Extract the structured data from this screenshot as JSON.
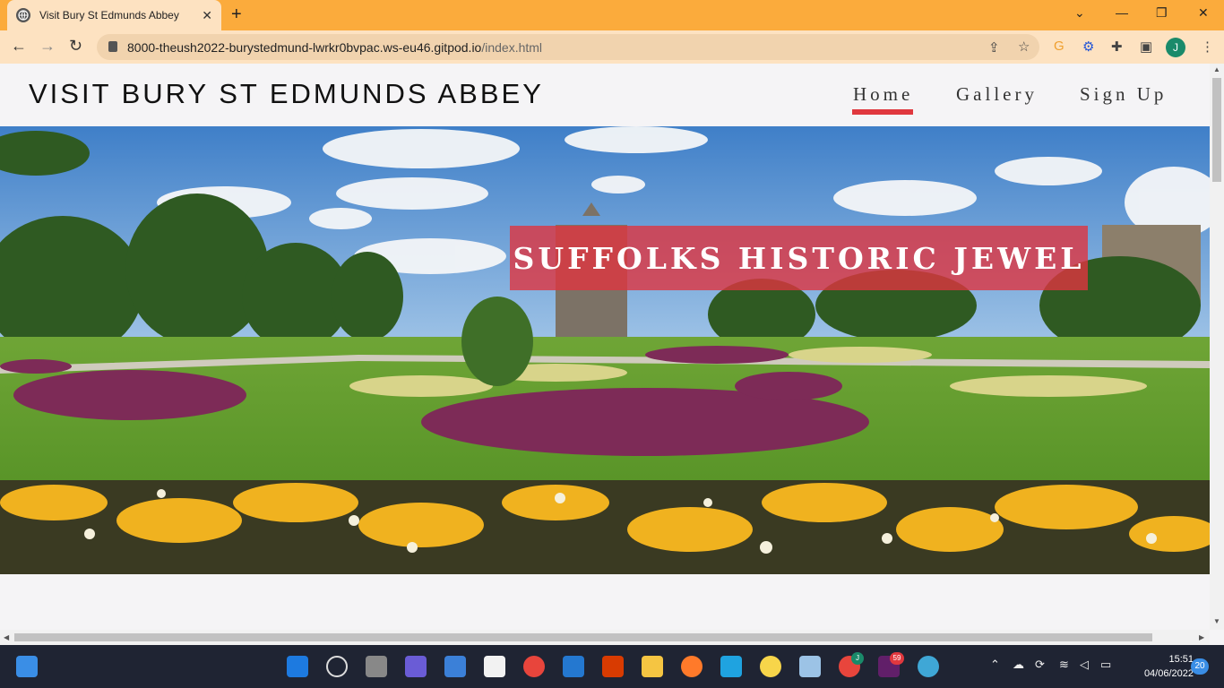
{
  "browser": {
    "tab_title": "Visit Bury St Edmunds Abbey",
    "url_host": "8000-theush2022-burystedmund-lwrkr0bvpac.ws-eu46.gitpod.io",
    "url_path": "/index.html",
    "profile_initial": "J"
  },
  "site": {
    "title": "VISIT BURY ST EDMUNDS ABBEY",
    "nav": [
      {
        "label": "Home",
        "active": true
      },
      {
        "label": "Gallery",
        "active": false
      },
      {
        "label": "Sign Up",
        "active": false
      }
    ],
    "hero_heading": "SUFFOLKS HISTORIC JEWEL",
    "accent_color": "#e0383e"
  },
  "taskbar": {
    "time": "15:51",
    "date": "04/06/2022",
    "notification_count": "20",
    "slack_badge": "59",
    "chrome_badge": "J"
  }
}
